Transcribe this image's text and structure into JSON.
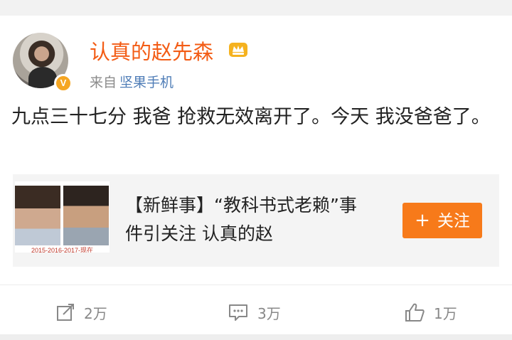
{
  "post": {
    "username": "认真的赵先森",
    "verified_badge": "V",
    "source_prefix": "来自",
    "source_device": "坚果手机",
    "text": "九点三十七分 我爸 抢救无效离开了。今天 我没爸爸了。"
  },
  "card": {
    "thumb_caption": "2015-2016-2017-现在",
    "title": "【新鲜事】“教科书式老赖”事件引关注 认真的赵",
    "follow_label": "关注",
    "follow_icon": "plus-icon"
  },
  "actions": {
    "repost": {
      "icon": "repost-icon",
      "count": "2万"
    },
    "comment": {
      "icon": "comment-icon",
      "count": "3万"
    },
    "like": {
      "icon": "like-icon",
      "count": "1万"
    }
  },
  "colors": {
    "username": "#f35c15",
    "source_device": "#4f7db7",
    "follow_button": "#f77a1a",
    "verified_badge": "#f5a623"
  }
}
